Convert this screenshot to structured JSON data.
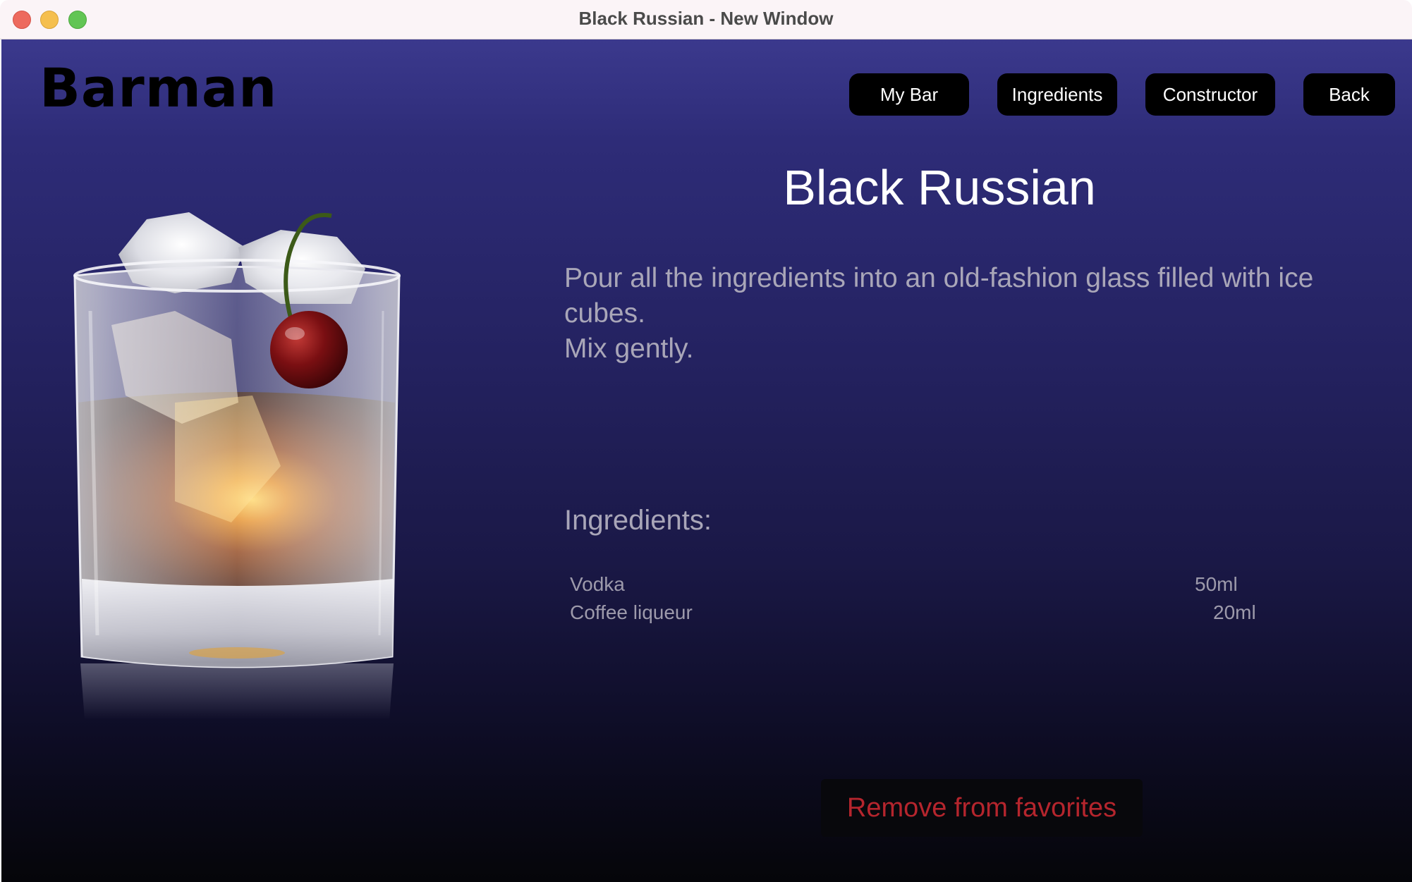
{
  "window": {
    "title": "Black Russian - New Window"
  },
  "app": {
    "logo": "Barman"
  },
  "nav": {
    "my_bar": "My Bar",
    "ingredients": "Ingredients",
    "constructor": "Constructor",
    "back": "Back"
  },
  "cocktail": {
    "name": "Black Russian",
    "instructions": [
      "Pour all the ingredients into an old-fashion glass filled with ice",
      "cubes.",
      "Mix gently."
    ],
    "ingredients_heading": "Ingredients:",
    "ingredients": [
      {
        "name": "Vodka",
        "amount": "50ml"
      },
      {
        "name": "Coffee liqueur",
        "amount": "20ml"
      }
    ],
    "image_icon": "cocktail-glass-image"
  },
  "actions": {
    "remove_favorite": "Remove from favorites"
  },
  "colors": {
    "accent_remove": "#b5252d",
    "nav_button": "#000000",
    "bg_top": "#3b398d",
    "bg_bottom": "#050509"
  }
}
